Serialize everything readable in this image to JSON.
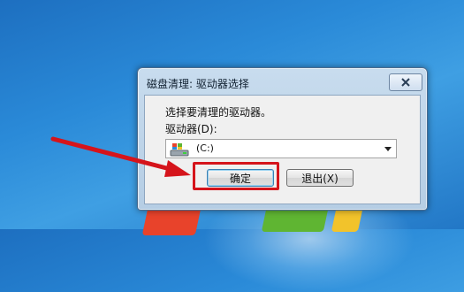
{
  "dialog": {
    "title": "磁盘清理: 驱动器选择",
    "prompt": "选择要清理的驱动器。",
    "drive_label": "驱动器(D):",
    "selected_drive": "(C:)",
    "ok_label": "确定",
    "cancel_label": "退出(X)"
  },
  "icons": {
    "close": "close-icon",
    "drive": "windows-drive-icon",
    "dropdown": "chevron-down-icon"
  },
  "colors": {
    "highlight": "#d5141b",
    "desktop": "#2a8ad8"
  }
}
